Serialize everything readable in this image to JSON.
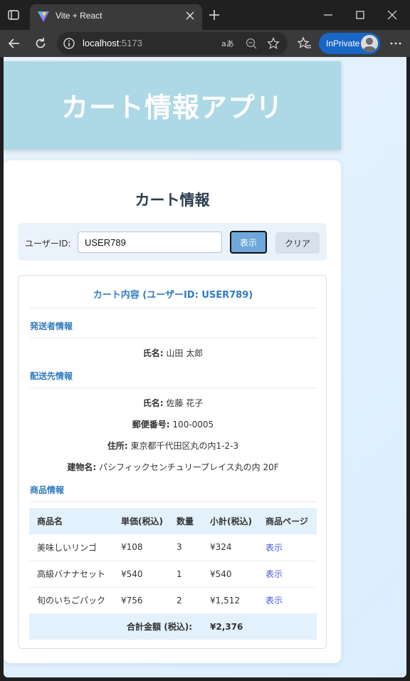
{
  "browser": {
    "tab_title": "Vite + React",
    "url_host": "localhost",
    "url_port": ":5173",
    "inprivate_label": "InPrivate"
  },
  "app": {
    "header_title": "カート情報アプリ",
    "card_title": "カート情報",
    "form": {
      "user_id_label": "ユーザーID:",
      "user_id_value": "USER789",
      "show_button": "表示",
      "clear_button": "クリア"
    },
    "content": {
      "title": "カート内容 (ユーザーID: USER789)",
      "sender": {
        "section_title": "発送者情報",
        "name_label": "氏名:",
        "name_value": "山田 太郎"
      },
      "shipping": {
        "section_title": "配送先情報",
        "name_label": "氏名:",
        "name_value": "佐藤 花子",
        "postal_label": "郵便番号:",
        "postal_value": "100-0005",
        "address_label": "住所:",
        "address_value": "東京都千代田区丸の内1-2-3",
        "building_label": "建物名:",
        "building_value": "パシフィックセンチュリープレイス丸の内 20F"
      },
      "products": {
        "section_title": "商品情報",
        "columns": [
          "商品名",
          "単価(税込)",
          "数量",
          "小計(税込)",
          "商品ページ"
        ],
        "rows": [
          [
            "美味しいリンゴ",
            "¥108",
            "3",
            "¥324",
            "表示"
          ],
          [
            "高級バナナセット",
            "¥540",
            "1",
            "¥540",
            "表示"
          ],
          [
            "旬のいちごパック",
            "¥756",
            "2",
            "¥1,512",
            "表示"
          ]
        ],
        "total_label": "合計金額 (税込):",
        "total_value": "¥2,376"
      }
    }
  },
  "colors": {
    "header_bg": "#add8e6",
    "accent": "#2f7bbf",
    "show_button": "#6fa7da",
    "link": "#4a57d6"
  }
}
